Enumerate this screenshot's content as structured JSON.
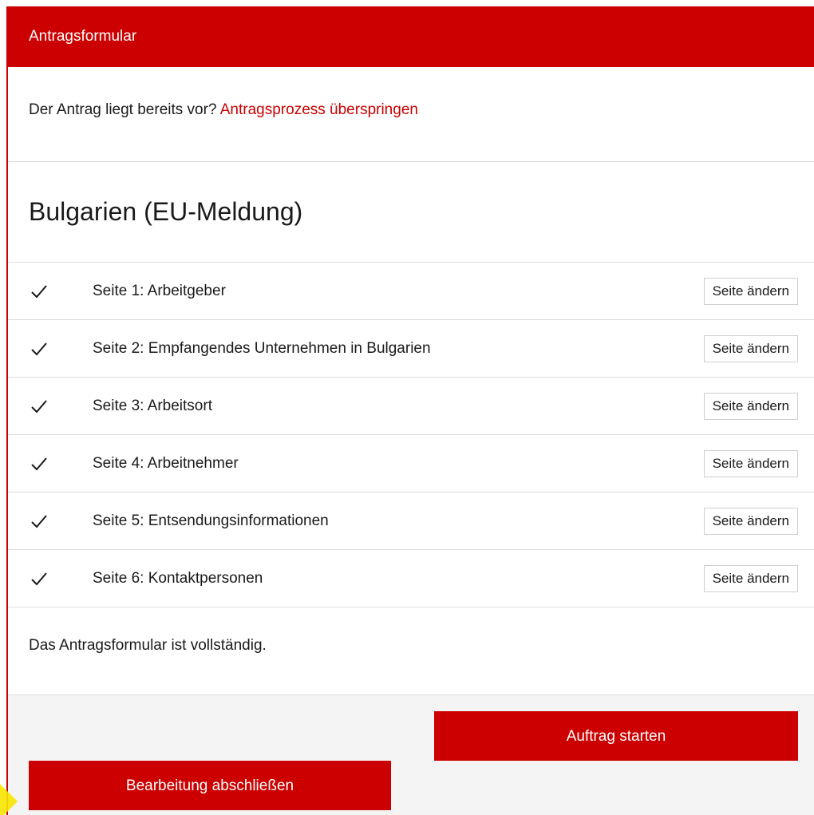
{
  "header": {
    "title": "Antragsformular"
  },
  "skip": {
    "prefix": "Der Antrag liegt bereits vor?",
    "link": "Antragsprozess überspringen"
  },
  "country": {
    "title": "Bulgarien (EU-Meldung)"
  },
  "steps": [
    {
      "label": "Seite 1: Arbeitgeber",
      "button": "Seite ändern",
      "done": true
    },
    {
      "label": "Seite 2: Empfangendes Unternehmen in Bulgarien",
      "button": "Seite ändern",
      "done": true
    },
    {
      "label": "Seite 3: Arbeitsort",
      "button": "Seite ändern",
      "done": true
    },
    {
      "label": "Seite 4: Arbeitnehmer",
      "button": "Seite ändern",
      "done": true
    },
    {
      "label": "Seite 5: Entsendungsinformationen",
      "button": "Seite ändern",
      "done": true
    },
    {
      "label": "Seite 6: Kontaktpersonen",
      "button": "Seite ändern",
      "done": true
    }
  ],
  "status": {
    "text": "Das Antragsformular ist vollständig."
  },
  "actions": {
    "start_label": "Auftrag starten",
    "finish_label": "Bearbeitung abschließen"
  },
  "colors": {
    "accent": "#cc0000",
    "footer_bg": "#f4f4f4",
    "cursor_highlight": "#f7e600"
  }
}
